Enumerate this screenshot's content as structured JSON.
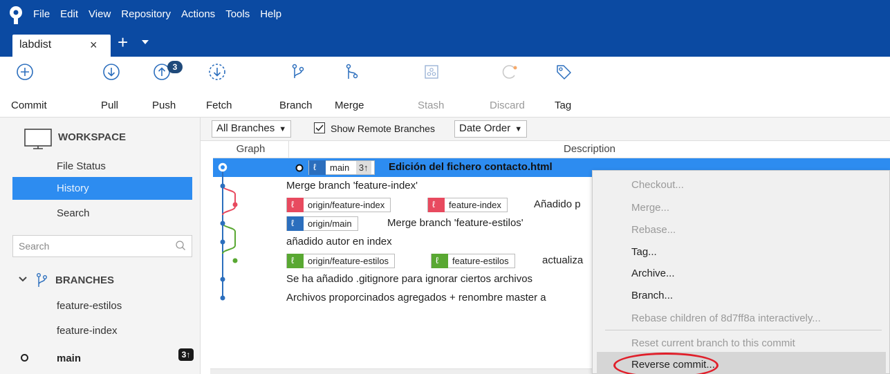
{
  "menu": [
    "File",
    "Edit",
    "View",
    "Repository",
    "Actions",
    "Tools",
    "Help"
  ],
  "tab": {
    "label": "labdist",
    "close": "×",
    "add": "+"
  },
  "toolbar": {
    "commit": "Commit",
    "pull": "Pull",
    "push": "Push",
    "push_badge": "3",
    "fetch": "Fetch",
    "branch": "Branch",
    "merge": "Merge",
    "stash": "Stash",
    "discard": "Discard",
    "tag": "Tag"
  },
  "sidebar": {
    "workspace_title": "WORKSPACE",
    "items": [
      "File Status",
      "History",
      "Search"
    ],
    "active_item": "History",
    "search_placeholder": "Search",
    "branches_title": "BRANCHES",
    "branches": [
      "feature-estilos",
      "feature-index"
    ],
    "current_branch": "main",
    "current_branch_badge": "3↑"
  },
  "filter": {
    "branches_select": "All Branches",
    "show_remote_label": "Show Remote Branches",
    "show_remote_checked": true,
    "order_select": "Date Order"
  },
  "columns": {
    "graph": "Graph",
    "description": "Description"
  },
  "commits": [
    {
      "refs": [
        {
          "name": "main",
          "color": "blue",
          "ahead": "3↑"
        }
      ],
      "message": "Edición del fichero contacto.html",
      "selected": true
    },
    {
      "refs": [],
      "message": "Merge branch 'feature-index'"
    },
    {
      "refs": [
        {
          "name": "origin/feature-index",
          "color": "red"
        },
        {
          "name": "feature-index",
          "color": "red"
        }
      ],
      "message": "Añadido p"
    },
    {
      "refs": [
        {
          "name": "origin/main",
          "color": "blue"
        }
      ],
      "message": "Merge branch 'feature-estilos'"
    },
    {
      "refs": [],
      "message": "añadido autor en index"
    },
    {
      "refs": [
        {
          "name": "origin/feature-estilos",
          "color": "green"
        },
        {
          "name": "feature-estilos",
          "color": "green"
        }
      ],
      "message": "actualiza"
    },
    {
      "refs": [],
      "message": "Se ha añadido .gitignore para ignorar ciertos archivos"
    },
    {
      "refs": [],
      "message": "Archivos proporcinados agregados + renombre master a"
    }
  ],
  "context_menu": {
    "checkout": "Checkout...",
    "merge": "Merge...",
    "rebase": "Rebase...",
    "tag": "Tag...",
    "archive": "Archive...",
    "branch": "Branch...",
    "rebase_children": "Rebase children of 8d7ff8a interactively...",
    "reset": "Reset current branch to this commit",
    "reverse": "Reverse commit..."
  },
  "colors": {
    "titlebar": "#0b4aa2",
    "accent": "#2d8cf0",
    "graph_blue": "#2b6ebd",
    "graph_red": "#e84a5f",
    "graph_green": "#59a832",
    "annotation_red": "#e01f2a"
  }
}
